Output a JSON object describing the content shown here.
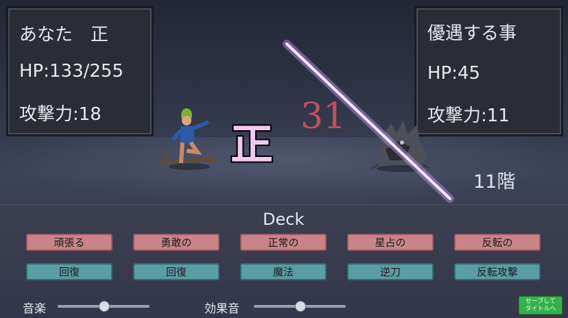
{
  "player": {
    "name": "あなた　正",
    "hp": "HP:133/255",
    "atk": "攻撃力:18"
  },
  "enemy": {
    "name": "優遇する事",
    "hp": "HP:45",
    "atk": "攻撃力:11"
  },
  "battle": {
    "word": "正",
    "damage": "31",
    "floor": "11階"
  },
  "deck": {
    "title": "Deck",
    "words": [
      "頑張る",
      "勇敢の",
      "正常の",
      "星占の",
      "反転の"
    ],
    "actions": [
      "回復",
      "回復",
      "魔法",
      "逆刀",
      "反転攻撃"
    ]
  },
  "settings": {
    "music_label": "音楽",
    "music_level": 0.5,
    "sfx_label": "効果音",
    "sfx_level": 0.5,
    "save_label_1": "セーブして",
    "save_label_2": "タイトルへ"
  }
}
